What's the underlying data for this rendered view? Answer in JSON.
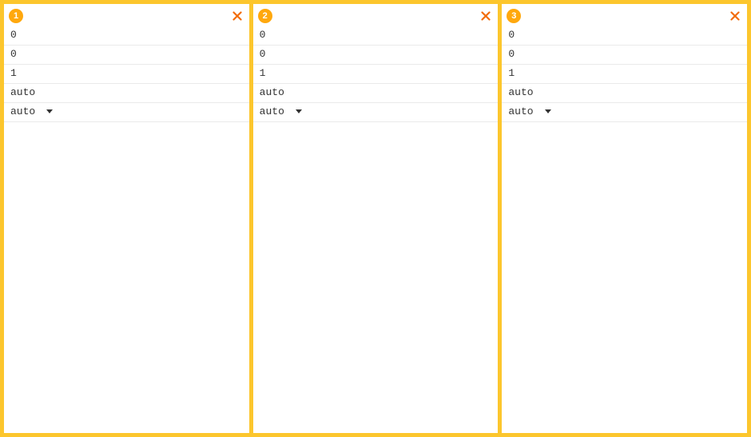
{
  "panels": [
    {
      "badge": "1",
      "rows": [
        {
          "type": "value",
          "value": "0"
        },
        {
          "type": "value",
          "value": "0"
        },
        {
          "type": "value",
          "value": "1"
        },
        {
          "type": "value",
          "value": "auto"
        },
        {
          "type": "select",
          "value": "auto"
        }
      ]
    },
    {
      "badge": "2",
      "rows": [
        {
          "type": "value",
          "value": "0"
        },
        {
          "type": "value",
          "value": "0"
        },
        {
          "type": "value",
          "value": "1"
        },
        {
          "type": "value",
          "value": "auto"
        },
        {
          "type": "select",
          "value": "auto"
        }
      ]
    },
    {
      "badge": "3",
      "rows": [
        {
          "type": "value",
          "value": "0"
        },
        {
          "type": "value",
          "value": "0"
        },
        {
          "type": "value",
          "value": "1"
        },
        {
          "type": "value",
          "value": "auto"
        },
        {
          "type": "select",
          "value": "auto"
        }
      ]
    }
  ]
}
